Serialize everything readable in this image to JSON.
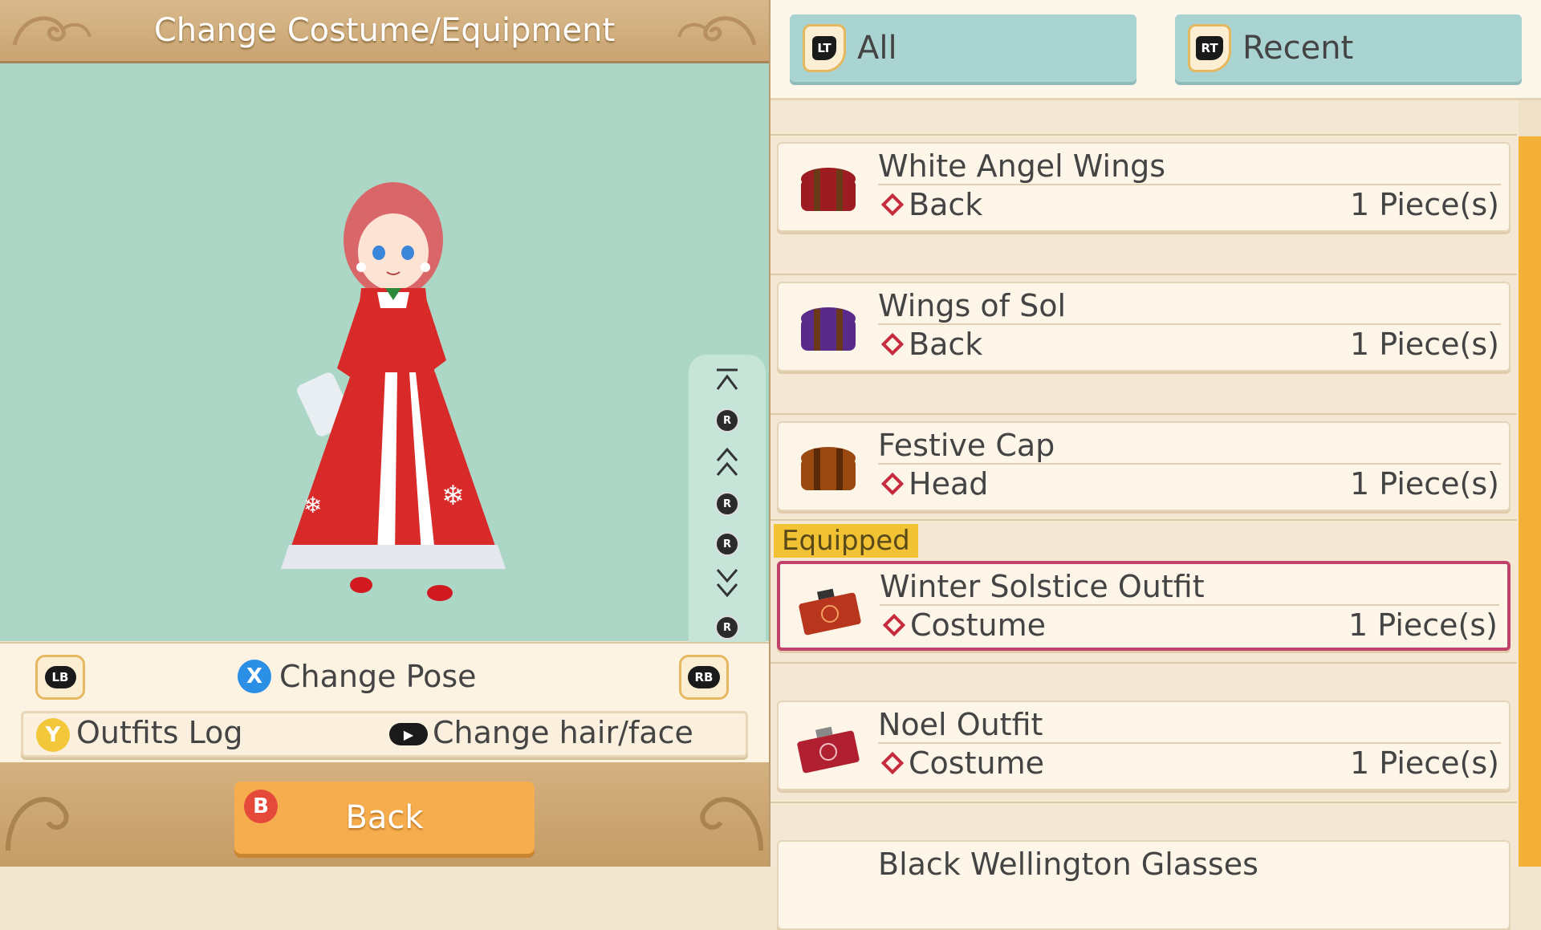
{
  "header": {
    "title": "Change Costume/Equipment"
  },
  "controls": {
    "lb": "LB",
    "rb": "RB",
    "pose_button": "X",
    "pose_label": "Change Pose",
    "outfits_button": "Y",
    "outfits_label": "Outfits Log",
    "hair_label": "Change hair/face"
  },
  "pose_rail": {
    "r_label": "R"
  },
  "footer": {
    "back_button": "B",
    "back_label": "Back"
  },
  "tabs": [
    {
      "trigger": "LT",
      "label": "All"
    },
    {
      "trigger": "RT",
      "label": "Recent"
    }
  ],
  "equipped_label": "Equipped",
  "items": [
    {
      "name": "White Angel Wings",
      "category": "Back",
      "qty": "1 Piece(s)",
      "box_color": "#9c1c22"
    },
    {
      "name": "Wings of Sol",
      "category": "Back",
      "qty": "1 Piece(s)",
      "box_color": "#5a2a8a"
    },
    {
      "name": "Festive Cap",
      "category": "Head",
      "qty": "1 Piece(s)",
      "box_color": "#9a4a10"
    },
    {
      "name": "Winter Solstice Outfit",
      "category": "Costume",
      "qty": "1 Piece(s)",
      "box_color": "#b8361e"
    },
    {
      "name": "Noel Outfit",
      "category": "Costume",
      "qty": "1 Piece(s)",
      "box_color": "#b02030"
    },
    {
      "name": "Black Wellington Glasses",
      "category": "",
      "qty": "",
      "box_color": "#444444"
    }
  ],
  "colors": {
    "stage": "#acd6c5",
    "accent": "#f5ad4e",
    "equipped_border": "#c0426a"
  }
}
